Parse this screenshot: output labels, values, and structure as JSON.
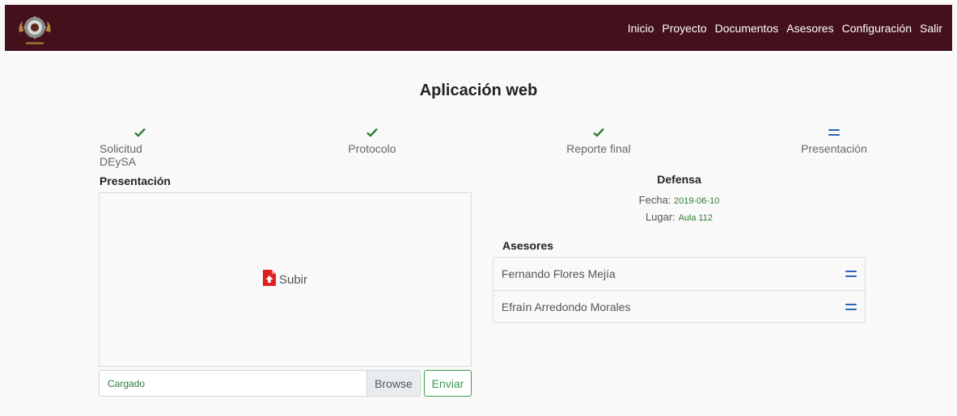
{
  "nav": {
    "links": [
      "Inicio",
      "Proyecto",
      "Documentos",
      "Asesores",
      "Configuración",
      "Salir"
    ]
  },
  "page": {
    "title": "Aplicación web"
  },
  "steps": [
    {
      "label": "Solicitud DEySA",
      "status": "done",
      "icon": "check-icon"
    },
    {
      "label": "Protocolo",
      "status": "done",
      "icon": "check-icon"
    },
    {
      "label": "Reporte final",
      "status": "done",
      "icon": "check-icon"
    },
    {
      "label": "Presentación",
      "status": "pending",
      "icon": "equals-icon"
    }
  ],
  "upload": {
    "section_title": "Presentación",
    "drop_label": "Subir",
    "file_value": "Cargado",
    "browse_label": "Browse",
    "send_label": "Enviar"
  },
  "defense": {
    "title": "Defensa",
    "date_label": "Fecha:",
    "date_value": "2019-06-10",
    "place_label": "Lugar:",
    "place_value": "Aula 112"
  },
  "advisors": {
    "title": "Asesores",
    "items": [
      "Fernando Flores Mejía",
      "Efraín Arredondo Morales"
    ]
  },
  "colors": {
    "navbar": "#43101b",
    "check": "#2e7d32",
    "equals": "#2a63b8",
    "upload_icon": "#e02020",
    "send_button": "#3c9a4f"
  }
}
